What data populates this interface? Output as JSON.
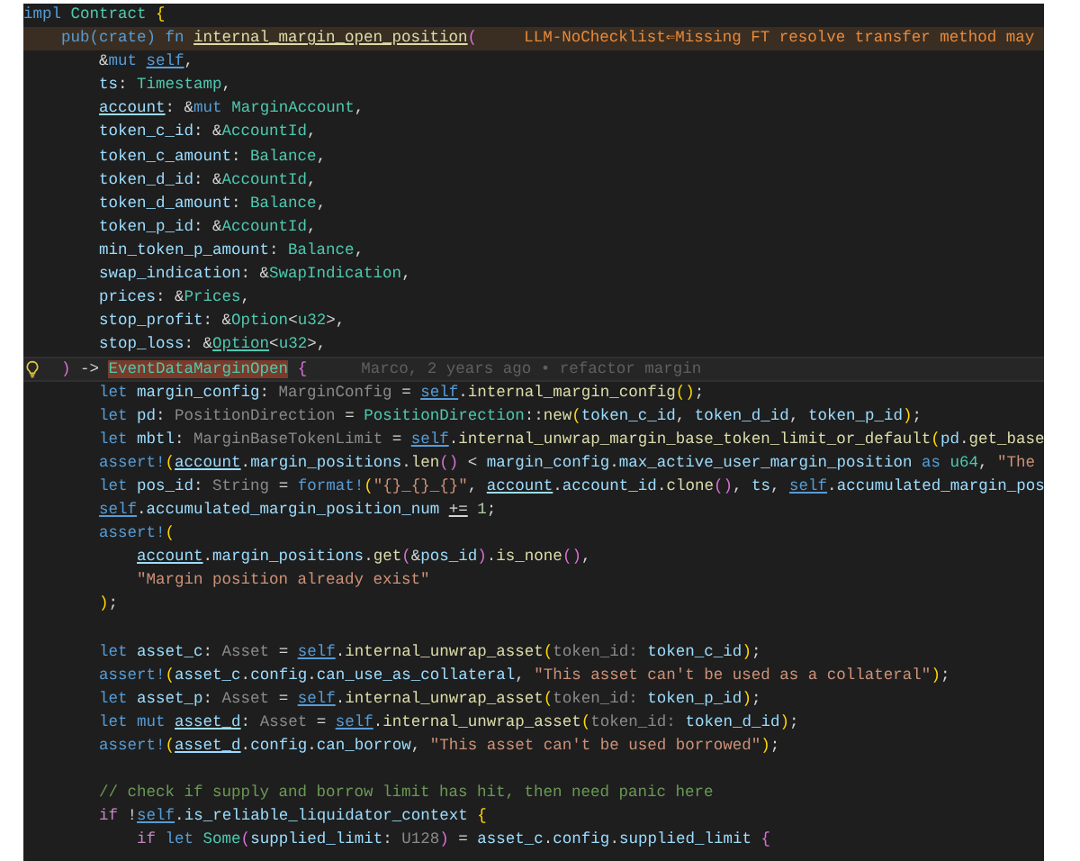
{
  "editor": {
    "lines": [
      {
        "kind": "code",
        "tokens": [
          {
            "text": "impl",
            "kind": "kw"
          },
          {
            "text": " Contract",
            "kind": "type"
          },
          {
            "text": " {",
            "kind": "bracket"
          }
        ]
      },
      {
        "kind": "diagnostic",
        "message": "LLM-NoChecklist⇐Missing FT resolve transfer method may",
        "tokens": [
          {
            "text": "    pub(crate) fn ",
            "kind": "kw"
          },
          {
            "text": "internal_margin_open_position",
            "kind": "fn_u"
          },
          {
            "text": "(",
            "kind": "bracket2"
          }
        ]
      },
      {
        "kind": "code",
        "tokens": [
          {
            "text": "        &",
            "kind": "p"
          },
          {
            "text": "mut ",
            "kind": "kw"
          },
          {
            "text": "self",
            "kind": "kw_u"
          },
          {
            "text": ",",
            "kind": "p"
          }
        ]
      },
      {
        "kind": "code",
        "tokens": [
          {
            "text": "        ts",
            "kind": "var"
          },
          {
            "text": ": ",
            "kind": "p"
          },
          {
            "text": "Timestamp",
            "kind": "type"
          },
          {
            "text": ",",
            "kind": "p"
          }
        ]
      },
      {
        "kind": "code",
        "tokens": [
          {
            "text": "        account",
            "kind": "var_u"
          },
          {
            "text": ": &",
            "kind": "p"
          },
          {
            "text": "mut ",
            "kind": "kw"
          },
          {
            "text": "MarginAccount",
            "kind": "type"
          },
          {
            "text": ",",
            "kind": "p"
          }
        ]
      },
      {
        "kind": "code",
        "tokens": [
          {
            "text": "        token_c_id",
            "kind": "var"
          },
          {
            "text": ": &",
            "kind": "p"
          },
          {
            "text": "AccountId",
            "kind": "type"
          },
          {
            "text": ",",
            "kind": "p"
          }
        ]
      },
      {
        "kind": "code",
        "tokens": [
          {
            "text": "        token_c_amount",
            "kind": "var"
          },
          {
            "text": ": ",
            "kind": "p"
          },
          {
            "text": "Balance",
            "kind": "type"
          },
          {
            "text": ",",
            "kind": "p"
          }
        ]
      },
      {
        "kind": "code",
        "tokens": [
          {
            "text": "        token_d_id",
            "kind": "var"
          },
          {
            "text": ": &",
            "kind": "p"
          },
          {
            "text": "AccountId",
            "kind": "type"
          },
          {
            "text": ",",
            "kind": "p"
          }
        ]
      },
      {
        "kind": "code",
        "tokens": [
          {
            "text": "        token_d_amount",
            "kind": "var"
          },
          {
            "text": ": ",
            "kind": "p"
          },
          {
            "text": "Balance",
            "kind": "type"
          },
          {
            "text": ",",
            "kind": "p"
          }
        ]
      },
      {
        "kind": "code",
        "tokens": [
          {
            "text": "        token_p_id",
            "kind": "var"
          },
          {
            "text": ": &",
            "kind": "p"
          },
          {
            "text": "AccountId",
            "kind": "type"
          },
          {
            "text": ",",
            "kind": "p"
          }
        ]
      },
      {
        "kind": "code",
        "tokens": [
          {
            "text": "        min_token_p_amount",
            "kind": "var"
          },
          {
            "text": ": ",
            "kind": "p"
          },
          {
            "text": "Balance",
            "kind": "type"
          },
          {
            "text": ",",
            "kind": "p"
          }
        ]
      },
      {
        "kind": "code",
        "tokens": [
          {
            "text": "        swap_indication",
            "kind": "var"
          },
          {
            "text": ": &",
            "kind": "p"
          },
          {
            "text": "SwapIndication",
            "kind": "type"
          },
          {
            "text": ",",
            "kind": "p"
          }
        ]
      },
      {
        "kind": "code",
        "tokens": [
          {
            "text": "        prices",
            "kind": "var"
          },
          {
            "text": ": &",
            "kind": "p"
          },
          {
            "text": "Prices",
            "kind": "type"
          },
          {
            "text": ",",
            "kind": "p"
          }
        ]
      },
      {
        "kind": "code",
        "tokens": [
          {
            "text": "        stop_profit",
            "kind": "var"
          },
          {
            "text": ": &",
            "kind": "p"
          },
          {
            "text": "Option",
            "kind": "type"
          },
          {
            "text": "<",
            "kind": "p"
          },
          {
            "text": "u32",
            "kind": "type"
          },
          {
            "text": ">,",
            "kind": "p"
          }
        ]
      },
      {
        "kind": "code",
        "tokens": [
          {
            "text": "        stop_loss",
            "kind": "var"
          },
          {
            "text": ": &",
            "kind": "p"
          },
          {
            "text": "Option",
            "kind": "type_u"
          },
          {
            "text": "<",
            "kind": "p"
          },
          {
            "text": "u32",
            "kind": "type"
          },
          {
            "text": ">,",
            "kind": "p"
          }
        ]
      },
      {
        "kind": "current",
        "blame": "Marco, 2 years ago • refactor margin",
        "tokens": [
          {
            "text": "    )",
            "kind": "bracket2"
          },
          {
            "text": " -> ",
            "kind": "p"
          },
          {
            "text": "EventDataMarginOpen",
            "kind": "type_hl"
          },
          {
            "text": " {",
            "kind": "bracket2"
          }
        ]
      },
      {
        "kind": "code",
        "tokens": [
          {
            "text": "        let",
            "kind": "kw"
          },
          {
            "text": " margin_config",
            "kind": "var"
          },
          {
            "text": ": ",
            "kind": "p"
          },
          {
            "text": "MarginConfig",
            "kind": "hint"
          },
          {
            "text": " = ",
            "kind": "p"
          },
          {
            "text": "self",
            "kind": "kw_u"
          },
          {
            "text": ".",
            "kind": "p"
          },
          {
            "text": "internal_margin_config",
            "kind": "fn"
          },
          {
            "text": "()",
            "kind": "bracket"
          },
          {
            "text": ";",
            "kind": "p"
          }
        ]
      },
      {
        "kind": "code",
        "tokens": [
          {
            "text": "        let",
            "kind": "kw"
          },
          {
            "text": " pd",
            "kind": "var"
          },
          {
            "text": ": ",
            "kind": "p"
          },
          {
            "text": "PositionDirection",
            "kind": "hint"
          },
          {
            "text": " = ",
            "kind": "p"
          },
          {
            "text": "PositionDirection",
            "kind": "type"
          },
          {
            "text": "::",
            "kind": "p"
          },
          {
            "text": "new",
            "kind": "fn"
          },
          {
            "text": "(",
            "kind": "bracket"
          },
          {
            "text": "token_c_id",
            "kind": "var"
          },
          {
            "text": ", ",
            "kind": "p"
          },
          {
            "text": "token_d_id",
            "kind": "var"
          },
          {
            "text": ", ",
            "kind": "p"
          },
          {
            "text": "token_p_id",
            "kind": "var"
          },
          {
            "text": ")",
            "kind": "bracket"
          },
          {
            "text": ";",
            "kind": "p"
          }
        ]
      },
      {
        "kind": "code",
        "tokens": [
          {
            "text": "        let",
            "kind": "kw"
          },
          {
            "text": " mbtl",
            "kind": "var"
          },
          {
            "text": ": ",
            "kind": "p"
          },
          {
            "text": "MarginBaseTokenLimit",
            "kind": "hint"
          },
          {
            "text": " = ",
            "kind": "p"
          },
          {
            "text": "self",
            "kind": "kw_u"
          },
          {
            "text": ".",
            "kind": "p"
          },
          {
            "text": "internal_unwrap_margin_base_token_limit_or_default",
            "kind": "fn"
          },
          {
            "text": "(",
            "kind": "bracket"
          },
          {
            "text": "pd",
            "kind": "var"
          },
          {
            "text": ".",
            "kind": "p"
          },
          {
            "text": "get_base",
            "kind": "fn"
          }
        ]
      },
      {
        "kind": "code",
        "tokens": [
          {
            "text": "        assert!",
            "kind": "kw"
          },
          {
            "text": "(",
            "kind": "bracket"
          },
          {
            "text": "account",
            "kind": "var_u"
          },
          {
            "text": ".",
            "kind": "p"
          },
          {
            "text": "margin_positions",
            "kind": "var"
          },
          {
            "text": ".",
            "kind": "p"
          },
          {
            "text": "len",
            "kind": "fn"
          },
          {
            "text": "()",
            "kind": "bracket2"
          },
          {
            "text": " < ",
            "kind": "p"
          },
          {
            "text": "margin_config",
            "kind": "var"
          },
          {
            "text": ".",
            "kind": "p"
          },
          {
            "text": "max_active_user_margin_position",
            "kind": "var"
          },
          {
            "text": " as",
            "kind": "kw"
          },
          {
            "text": " u64",
            "kind": "type"
          },
          {
            "text": ", ",
            "kind": "p"
          },
          {
            "text": "\"The",
            "kind": "str"
          }
        ]
      },
      {
        "kind": "code",
        "tokens": [
          {
            "text": "        let",
            "kind": "kw"
          },
          {
            "text": " pos_id",
            "kind": "var"
          },
          {
            "text": ": ",
            "kind": "p"
          },
          {
            "text": "String",
            "kind": "hint"
          },
          {
            "text": " = ",
            "kind": "p"
          },
          {
            "text": "format!",
            "kind": "kw"
          },
          {
            "text": "(",
            "kind": "bracket"
          },
          {
            "text": "\"{}_{}_{}\"",
            "kind": "str"
          },
          {
            "text": ", ",
            "kind": "p"
          },
          {
            "text": "account",
            "kind": "var_u"
          },
          {
            "text": ".",
            "kind": "p"
          },
          {
            "text": "account_id",
            "kind": "var"
          },
          {
            "text": ".",
            "kind": "p"
          },
          {
            "text": "clone",
            "kind": "fn"
          },
          {
            "text": "()",
            "kind": "bracket2"
          },
          {
            "text": ", ",
            "kind": "p"
          },
          {
            "text": "ts",
            "kind": "var"
          },
          {
            "text": ", ",
            "kind": "p"
          },
          {
            "text": "self",
            "kind": "kw_u"
          },
          {
            "text": ".",
            "kind": "p"
          },
          {
            "text": "accumulated_margin_pos",
            "kind": "var"
          }
        ]
      },
      {
        "kind": "code",
        "tokens": [
          {
            "text": "        self",
            "kind": "kw_u"
          },
          {
            "text": ".",
            "kind": "p"
          },
          {
            "text": "accumulated_margin_position_num",
            "kind": "var"
          },
          {
            "text": " +=",
            "kind": "p_u"
          },
          {
            "text": " 1",
            "kind": "num"
          },
          {
            "text": ";",
            "kind": "p"
          }
        ]
      },
      {
        "kind": "code",
        "tokens": [
          {
            "text": "        assert!",
            "kind": "kw"
          },
          {
            "text": "(",
            "kind": "bracket"
          }
        ]
      },
      {
        "kind": "code",
        "tokens": [
          {
            "text": "            account",
            "kind": "var_u"
          },
          {
            "text": ".",
            "kind": "p"
          },
          {
            "text": "margin_positions",
            "kind": "var"
          },
          {
            "text": ".",
            "kind": "p"
          },
          {
            "text": "get",
            "kind": "fn"
          },
          {
            "text": "(",
            "kind": "bracket2"
          },
          {
            "text": "&",
            "kind": "p"
          },
          {
            "text": "pos_id",
            "kind": "var"
          },
          {
            "text": ")",
            "kind": "bracket2"
          },
          {
            "text": ".",
            "kind": "p"
          },
          {
            "text": "is_none",
            "kind": "fn"
          },
          {
            "text": "()",
            "kind": "bracket2"
          },
          {
            "text": ",",
            "kind": "p"
          }
        ]
      },
      {
        "kind": "code",
        "tokens": [
          {
            "text": "            \"Margin position already exist\"",
            "kind": "str"
          }
        ]
      },
      {
        "kind": "code",
        "tokens": [
          {
            "text": "        )",
            "kind": "bracket"
          },
          {
            "text": ";",
            "kind": "p"
          }
        ]
      },
      {
        "kind": "blank"
      },
      {
        "kind": "code",
        "tokens": [
          {
            "text": "        let",
            "kind": "kw"
          },
          {
            "text": " asset_c",
            "kind": "var"
          },
          {
            "text": ": ",
            "kind": "p"
          },
          {
            "text": "Asset",
            "kind": "hint"
          },
          {
            "text": " = ",
            "kind": "p"
          },
          {
            "text": "self",
            "kind": "kw_u"
          },
          {
            "text": ".",
            "kind": "p"
          },
          {
            "text": "internal_unwrap_asset",
            "kind": "fn"
          },
          {
            "text": "(",
            "kind": "bracket"
          },
          {
            "text": "token_id: ",
            "kind": "hint"
          },
          {
            "text": "token_c_id",
            "kind": "var"
          },
          {
            "text": ")",
            "kind": "bracket"
          },
          {
            "text": ";",
            "kind": "p"
          }
        ]
      },
      {
        "kind": "code",
        "tokens": [
          {
            "text": "        assert!",
            "kind": "kw"
          },
          {
            "text": "(",
            "kind": "bracket"
          },
          {
            "text": "asset_c",
            "kind": "var"
          },
          {
            "text": ".",
            "kind": "p"
          },
          {
            "text": "config",
            "kind": "var"
          },
          {
            "text": ".",
            "kind": "p"
          },
          {
            "text": "can_use_as_collateral",
            "kind": "var"
          },
          {
            "text": ", ",
            "kind": "p"
          },
          {
            "text": "\"This asset can't be used as a collateral\"",
            "kind": "str"
          },
          {
            "text": ")",
            "kind": "bracket"
          },
          {
            "text": ";",
            "kind": "p"
          }
        ]
      },
      {
        "kind": "code",
        "tokens": [
          {
            "text": "        let",
            "kind": "kw"
          },
          {
            "text": " asset_p",
            "kind": "var"
          },
          {
            "text": ": ",
            "kind": "p"
          },
          {
            "text": "Asset",
            "kind": "hint"
          },
          {
            "text": " = ",
            "kind": "p"
          },
          {
            "text": "self",
            "kind": "kw_u"
          },
          {
            "text": ".",
            "kind": "p"
          },
          {
            "text": "internal_unwrap_asset",
            "kind": "fn"
          },
          {
            "text": "(",
            "kind": "bracket"
          },
          {
            "text": "token_id: ",
            "kind": "hint"
          },
          {
            "text": "token_p_id",
            "kind": "var"
          },
          {
            "text": ")",
            "kind": "bracket"
          },
          {
            "text": ";",
            "kind": "p"
          }
        ]
      },
      {
        "kind": "code",
        "tokens": [
          {
            "text": "        let",
            "kind": "kw"
          },
          {
            "text": " mut ",
            "kind": "kw"
          },
          {
            "text": "asset_d",
            "kind": "var_u"
          },
          {
            "text": ": ",
            "kind": "p"
          },
          {
            "text": "Asset",
            "kind": "hint"
          },
          {
            "text": " = ",
            "kind": "p"
          },
          {
            "text": "self",
            "kind": "kw_u"
          },
          {
            "text": ".",
            "kind": "p"
          },
          {
            "text": "internal_unwrap_asset",
            "kind": "fn"
          },
          {
            "text": "(",
            "kind": "bracket"
          },
          {
            "text": "token_id: ",
            "kind": "hint"
          },
          {
            "text": "token_d_id",
            "kind": "var"
          },
          {
            "text": ")",
            "kind": "bracket"
          },
          {
            "text": ";",
            "kind": "p"
          }
        ]
      },
      {
        "kind": "code",
        "tokens": [
          {
            "text": "        assert!",
            "kind": "kw"
          },
          {
            "text": "(",
            "kind": "bracket"
          },
          {
            "text": "asset_d",
            "kind": "var_u"
          },
          {
            "text": ".",
            "kind": "p"
          },
          {
            "text": "config",
            "kind": "var"
          },
          {
            "text": ".",
            "kind": "p"
          },
          {
            "text": "can_borrow",
            "kind": "var"
          },
          {
            "text": ", ",
            "kind": "p"
          },
          {
            "text": "\"This asset can't be used borrowed\"",
            "kind": "str"
          },
          {
            "text": ")",
            "kind": "bracket"
          },
          {
            "text": ";",
            "kind": "p"
          }
        ]
      },
      {
        "kind": "blank"
      },
      {
        "kind": "code",
        "tokens": [
          {
            "text": "        // check if supply and borrow limit has hit, then need panic here",
            "kind": "cmt"
          }
        ]
      },
      {
        "kind": "code",
        "tokens": [
          {
            "text": "        if",
            "kind": "ctrl"
          },
          {
            "text": " !",
            "kind": "p"
          },
          {
            "text": "self",
            "kind": "kw_u"
          },
          {
            "text": ".",
            "kind": "p"
          },
          {
            "text": "is_reliable_liquidator_context",
            "kind": "var"
          },
          {
            "text": " {",
            "kind": "bracket"
          }
        ]
      },
      {
        "kind": "code",
        "tokens": [
          {
            "text": "            if",
            "kind": "ctrl"
          },
          {
            "text": " let",
            "kind": "kw"
          },
          {
            "text": " Some",
            "kind": "type"
          },
          {
            "text": "(",
            "kind": "bracket2"
          },
          {
            "text": "supplied_limit",
            "kind": "var"
          },
          {
            "text": ": ",
            "kind": "p"
          },
          {
            "text": "U128",
            "kind": "hint"
          },
          {
            "text": ")",
            "kind": "bracket2"
          },
          {
            "text": " = ",
            "kind": "p"
          },
          {
            "text": "asset_c",
            "kind": "var"
          },
          {
            "text": ".",
            "kind": "p"
          },
          {
            "text": "config",
            "kind": "var"
          },
          {
            "text": ".",
            "kind": "p"
          },
          {
            "text": "supplied_limit",
            "kind": "var"
          },
          {
            "text": " {",
            "kind": "bracket2"
          }
        ]
      }
    ]
  }
}
